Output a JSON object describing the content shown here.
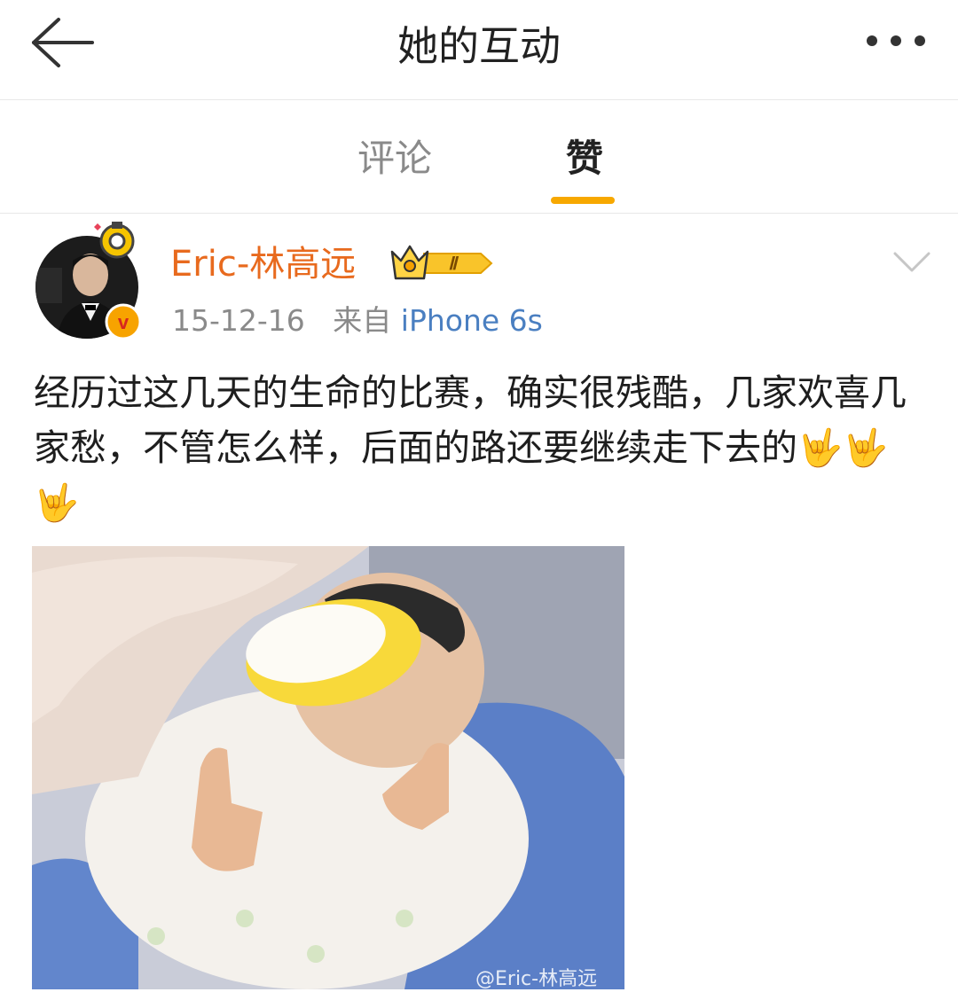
{
  "header": {
    "title": "她的互动",
    "back_icon": "back-arrow-icon",
    "more_icon": "more-dots-icon"
  },
  "tabs": [
    {
      "label": "评论",
      "active": false
    },
    {
      "label": "赞",
      "active": true
    }
  ],
  "colors": {
    "accent": "#f7a800",
    "username": "#e86a1e",
    "source_link": "#4a7fc1",
    "muted": "#8a8a8a"
  },
  "post": {
    "author": "Eric-林高远",
    "vip_level": "Ⅱ",
    "date": "15-12-16",
    "source_prefix": "来自",
    "source": "iPhone 6s",
    "text": "经历过这几天的生命的比赛，确实很残酷，几家欢喜几家愁，不管怎么样，后面的路还要继续走下去的🤟🤟🤟",
    "image_watermark": "@Eric-林高远"
  }
}
